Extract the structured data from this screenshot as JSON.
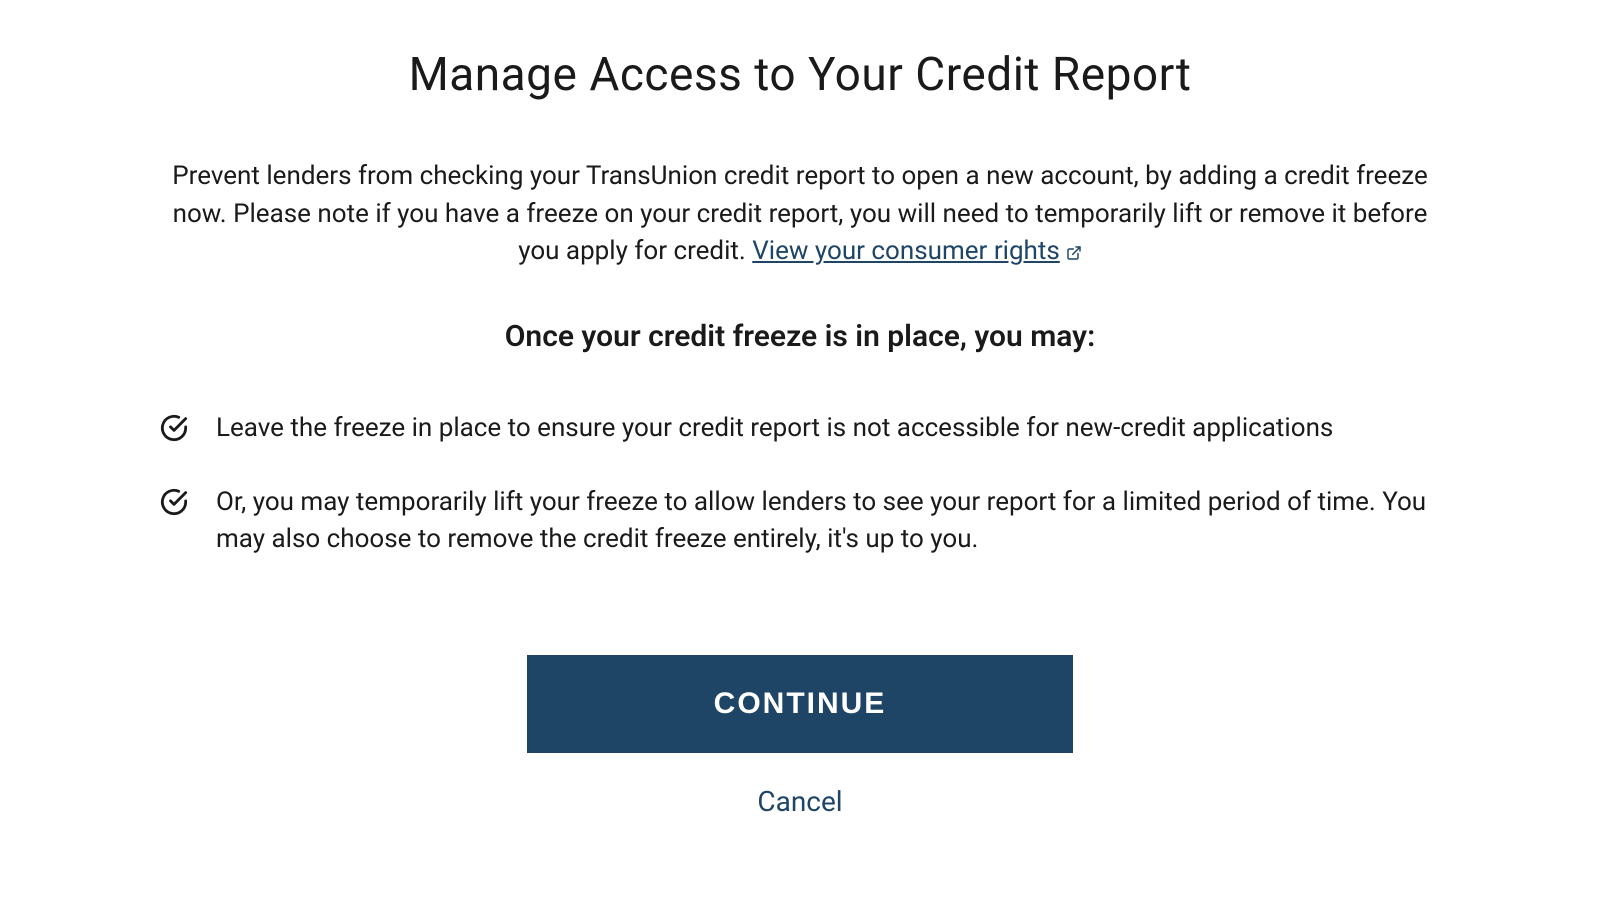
{
  "page": {
    "title": "Manage Access to Your Credit Report",
    "intro_text_before_link": "Prevent lenders from checking your TransUnion credit report to open a new account, by adding a credit freeze now. Please note if you have a freeze on your credit report, you will need to temporarily lift or remove it before you apply for credit. ",
    "rights_link_label": "View your consumer rights",
    "subheading": "Once your credit freeze is in place, you may:",
    "benefits": [
      "Leave the freeze in place to ensure your credit report is not accessible for new-credit applications",
      "Or, you may temporarily lift your freeze to allow lenders to see your report for a limited period of time. You may also choose to remove the credit freeze entirely, it's up to you."
    ],
    "continue_label": "CONTINUE",
    "cancel_label": "Cancel"
  },
  "colors": {
    "accent": "#1e4566",
    "text": "#1a1a1a",
    "background": "#ffffff"
  }
}
